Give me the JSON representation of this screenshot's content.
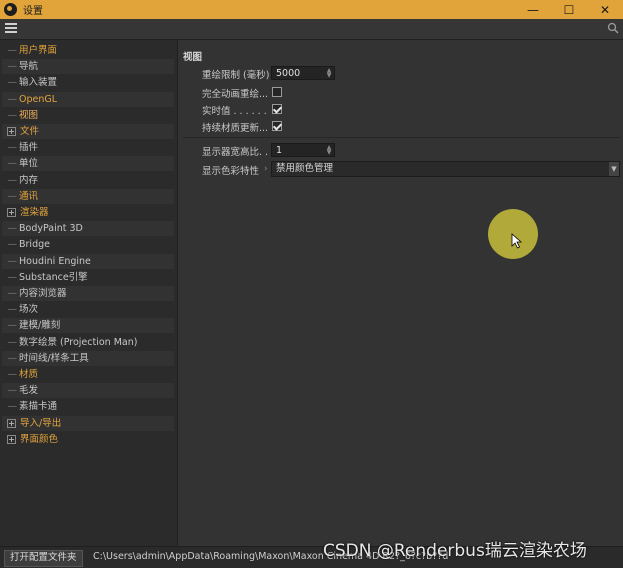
{
  "window": {
    "title": "设置",
    "minimize": "—",
    "maximize": "☐",
    "close": "✕"
  },
  "sidebar": {
    "items": [
      {
        "label": "用户界面",
        "prefix": "—",
        "style": "orange"
      },
      {
        "label": "导航",
        "prefix": "—",
        "style": "normal"
      },
      {
        "label": "输入装置",
        "prefix": "—",
        "style": "normal"
      },
      {
        "label": "OpenGL",
        "prefix": "—",
        "style": "orange"
      },
      {
        "label": "视图",
        "prefix": "—",
        "style": "sel"
      },
      {
        "label": "文件",
        "prefix": "+",
        "style": "orange"
      },
      {
        "label": "插件",
        "prefix": "—",
        "style": "normal"
      },
      {
        "label": "单位",
        "prefix": "—",
        "style": "normal"
      },
      {
        "label": "内存",
        "prefix": "—",
        "style": "normal"
      },
      {
        "label": "通讯",
        "prefix": "—",
        "style": "orange"
      },
      {
        "label": "渲染器",
        "prefix": "+",
        "style": "orange"
      },
      {
        "label": "BodyPaint 3D",
        "prefix": "—",
        "style": "normal"
      },
      {
        "label": "Bridge",
        "prefix": "—",
        "style": "normal"
      },
      {
        "label": "Houdini Engine",
        "prefix": "—",
        "style": "normal"
      },
      {
        "label": "Substance引擎",
        "prefix": "—",
        "style": "normal"
      },
      {
        "label": "内容浏览器",
        "prefix": "—",
        "style": "normal"
      },
      {
        "label": "场次",
        "prefix": "—",
        "style": "normal"
      },
      {
        "label": "建模/雕刻",
        "prefix": "—",
        "style": "normal"
      },
      {
        "label": "数字绘景 (Projection Man)",
        "prefix": "—",
        "style": "normal"
      },
      {
        "label": "时间线/样条工具",
        "prefix": "—",
        "style": "normal"
      },
      {
        "label": "材质",
        "prefix": "—",
        "style": "orange"
      },
      {
        "label": "毛发",
        "prefix": "—",
        "style": "normal"
      },
      {
        "label": "素描卡通",
        "prefix": "—",
        "style": "normal"
      },
      {
        "label": "导入/导出",
        "prefix": "+",
        "style": "orange"
      },
      {
        "label": "界面颜色",
        "prefix": "+",
        "style": "orange"
      }
    ]
  },
  "main": {
    "section_title": "视图",
    "redraw_limit_label": "重绘限制 (毫秒)",
    "redraw_limit_value": "5000",
    "full_anim_redraw_label": "完全动画重绘...",
    "full_anim_redraw_checked": false,
    "realtime_label": "实时值 . . . . . .",
    "realtime_checked": true,
    "continuous_material_label": "持续材质更新...",
    "continuous_material_checked": true,
    "aspect_label": "显示器宽高比. . .",
    "aspect_value": "1",
    "color_profile_label": "显示色彩特性",
    "color_profile_value": "禁用颜色管理"
  },
  "bottom": {
    "open_config_button": "打开配置文件夹",
    "config_path": "C:\\Users\\admin\\AppData\\Roaming\\Maxon\\Maxon Cinema 4D R2?_6?c?b??d"
  },
  "watermark": "CSDN @Renderbus瑞云渲染农场"
}
